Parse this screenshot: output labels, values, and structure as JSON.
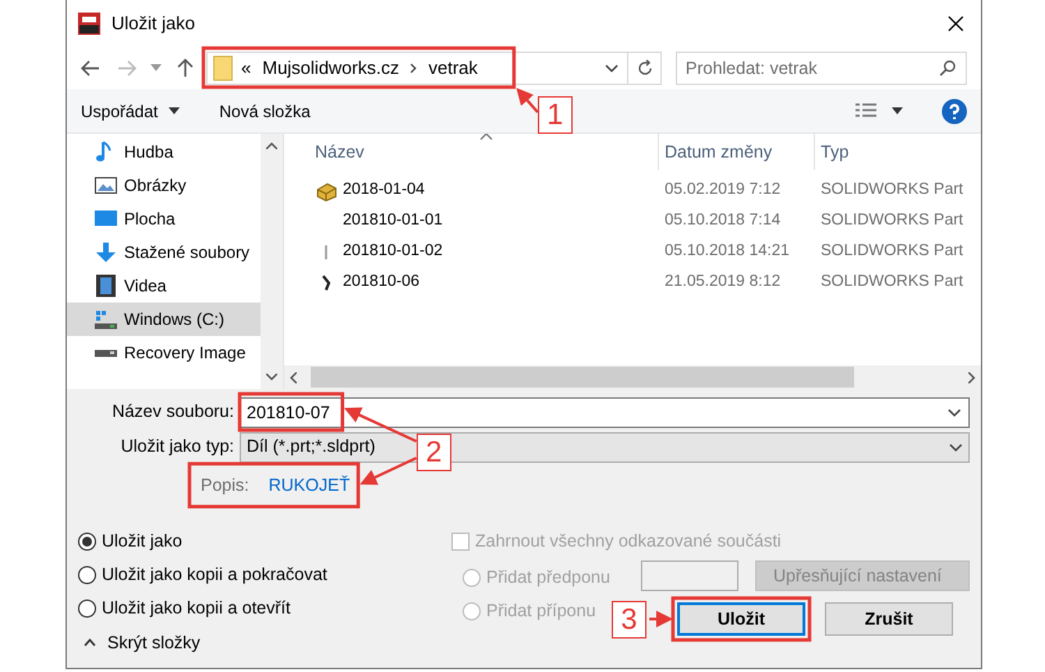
{
  "window": {
    "title": "Uložit jako"
  },
  "address": {
    "segments": [
      "«",
      "Mujsolidworks.cz",
      "vetrak"
    ]
  },
  "search": {
    "placeholder": "Prohledat: vetrak"
  },
  "toolbar": {
    "organize": "Uspořádat",
    "new_folder": "Nová složka"
  },
  "sidebar": {
    "items": [
      {
        "label": "Hudba",
        "selected": false
      },
      {
        "label": "Obrázky",
        "selected": false
      },
      {
        "label": "Plocha",
        "selected": false
      },
      {
        "label": "Stažené soubory",
        "selected": false
      },
      {
        "label": "Videa",
        "selected": false
      },
      {
        "label": "Windows (C:)",
        "selected": true
      },
      {
        "label": "Recovery Image",
        "selected": false
      }
    ]
  },
  "table": {
    "columns": [
      "Název",
      "Datum změny",
      "Typ"
    ],
    "rows": [
      {
        "name": "2018-01-04",
        "date": "05.02.2019 7:12",
        "type": "SOLIDWORKS Part"
      },
      {
        "name": "201810-01-01",
        "date": "05.10.2018 7:14",
        "type": "SOLIDWORKS Part"
      },
      {
        "name": "201810-01-02",
        "date": "05.10.2018 14:21",
        "type": "SOLIDWORKS Part"
      },
      {
        "name": "201810-06",
        "date": "21.05.2019 8:12",
        "type": "SOLIDWORKS Part"
      }
    ]
  },
  "form": {
    "file_name": {
      "label": "Název souboru:",
      "value": "201810-07"
    },
    "file_type": {
      "label": "Uložit jako typ:",
      "value": "Díl (*.prt;*.sldprt)"
    },
    "description": {
      "label": "Popis:",
      "value": "RUKOJEŤ"
    }
  },
  "save_options": [
    {
      "label": "Uložit jako",
      "selected": true
    },
    {
      "label": "Uložit jako kopii a pokračovat",
      "selected": false
    },
    {
      "label": "Uložit jako kopii a otevřít",
      "selected": false
    }
  ],
  "include_references": {
    "label": "Zahrnout všechny odkazované součásti",
    "checked": false,
    "disabled": true
  },
  "affix_options": [
    {
      "label": "Přidat předponu",
      "selected": false,
      "disabled": true
    },
    {
      "label": "Přidat příponu",
      "selected": false,
      "disabled": true
    }
  ],
  "advanced_button": {
    "label": "Upřesňující nastavení",
    "disabled": true
  },
  "hide_folders": "Skrýt složky",
  "buttons": [
    {
      "label": "Uložit",
      "default": true
    },
    {
      "label": "Zrušit",
      "default": false
    }
  ],
  "annotations": [
    {
      "label": "1"
    },
    {
      "label": "2"
    },
    {
      "label": "3"
    }
  ]
}
